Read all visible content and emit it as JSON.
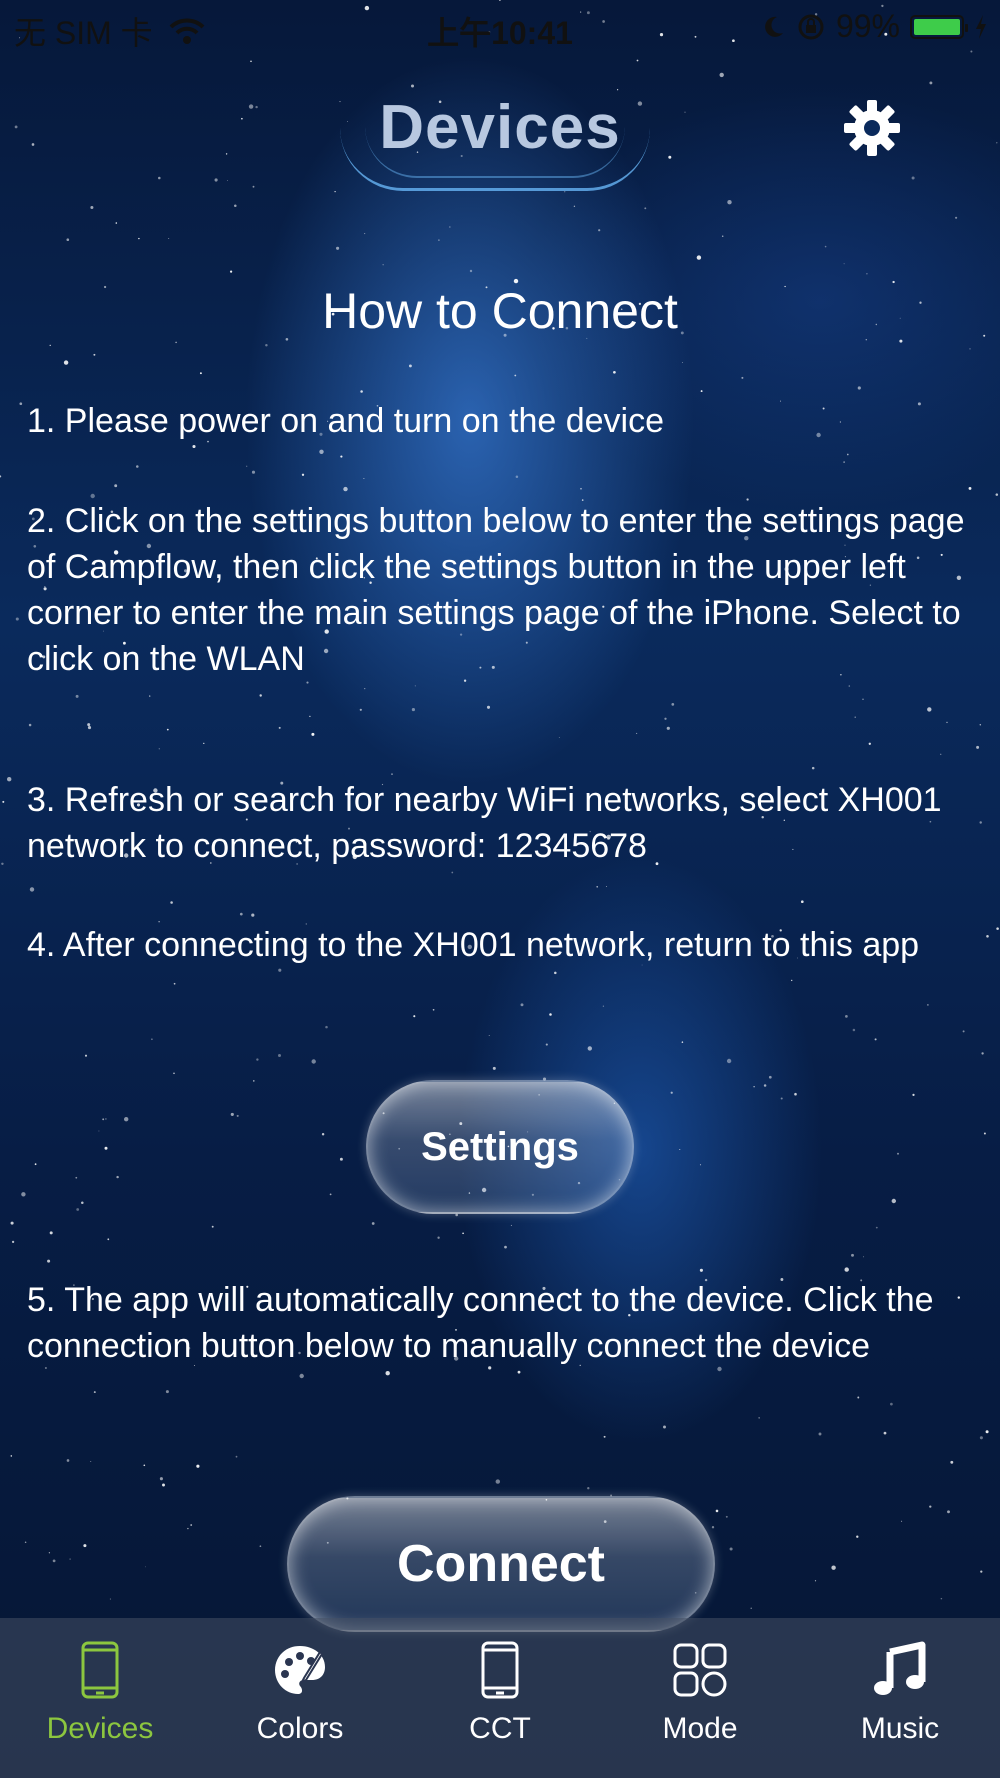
{
  "status_bar": {
    "carrier": "无 SIM 卡",
    "time": "上午10:41",
    "battery": "99%"
  },
  "header": {
    "title": "Devices"
  },
  "content": {
    "section_title": "How to Connect",
    "steps": [
      "1. Please power on and turn on the device",
      "2. Click on the settings button below to enter the settings page of Campflow, then click the settings button in the upper left corner to enter the main settings page of the iPhone. Select to click on the WLAN",
      "3. Refresh or search for nearby WiFi networks, select XH001 network to connect, password: 12345678",
      "4. After connecting to the XH001 network, return to this app",
      "5. The app will automatically connect to the device. Click the connection button below to manually connect the device"
    ],
    "settings_button": "Settings",
    "connect_button": "Connect"
  },
  "tabs": [
    {
      "label": "Devices",
      "icon": "phone-icon",
      "active": true
    },
    {
      "label": "Colors",
      "icon": "palette-icon",
      "active": false
    },
    {
      "label": "CCT",
      "icon": "phone-icon",
      "active": false
    },
    {
      "label": "Mode",
      "icon": "grid-icon",
      "active": false
    },
    {
      "label": "Music",
      "icon": "music-note-icon",
      "active": false
    }
  ],
  "colors": {
    "active_tab": "#8cc63f",
    "battery": "#3ecc4a"
  }
}
